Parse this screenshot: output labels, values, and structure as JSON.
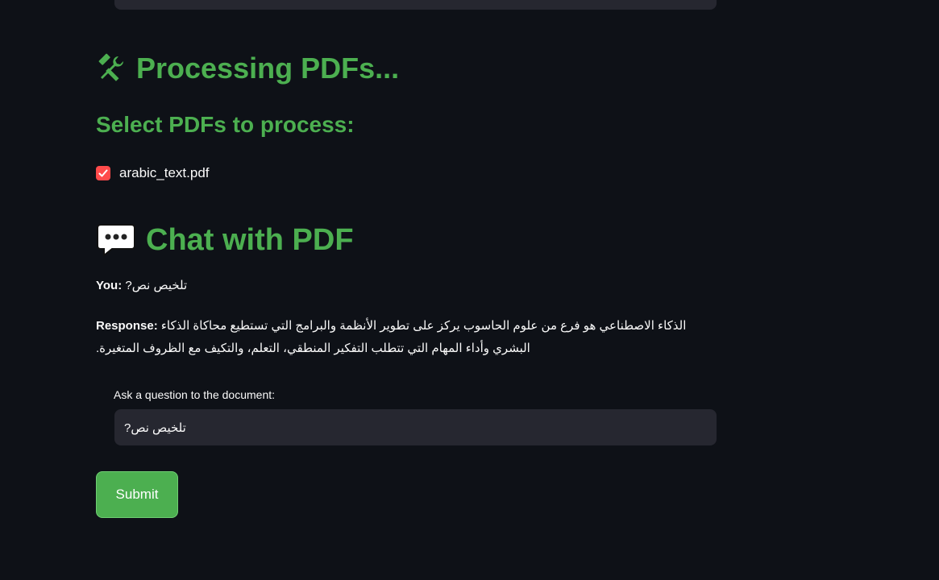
{
  "colors": {
    "background": "#0e1117",
    "accent_green": "#4caf50",
    "input_background": "#262730",
    "checkbox_red": "#ff4b4b",
    "text": "#fafafa"
  },
  "processing": {
    "icon": "tools-icon",
    "title": "Processing PDFs...",
    "subtitle": "Select PDFs to process:"
  },
  "pdf_list": [
    {
      "filename": "arabic_text.pdf",
      "checked": true
    }
  ],
  "chat": {
    "icon": "speech-bubble-icon",
    "title": "Chat with PDF",
    "you_label": "You:",
    "you_text": "تلخيص نص?",
    "response_label": "Response:",
    "response_text": "الذكاء الاصطناعي هو فرع من علوم الحاسوب يركز على تطوير الأنظمة والبرامج التي تستطيع محاكاة الذكاء البشري وأداء المهام التي تتطلب التفكير المنطقي، التعلم، والتكيف مع الظروف المتغيرة."
  },
  "question_input": {
    "label": "Ask a question to the document:",
    "value": "تلخيص نص?"
  },
  "submit_label": "Submit"
}
